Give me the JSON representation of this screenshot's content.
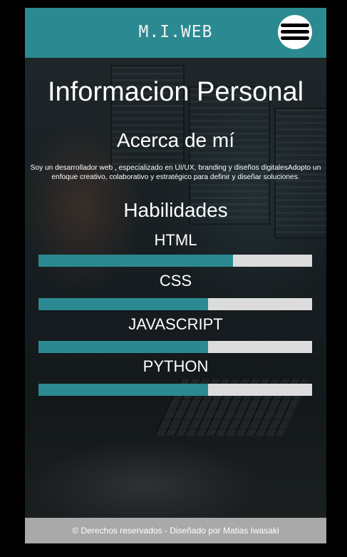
{
  "header": {
    "brand": "M.I.WEB",
    "menu_icon": "hamburger-menu-icon"
  },
  "main": {
    "title": "Informacion Personal",
    "about_heading": "Acerca de mí",
    "about_text": "Soy un desarrollador web , especializado en UI/UX, branding y diseños digitalesAdopto un enfoque creativo, colaborativo y estratégico para definir y diseñar soluciones.",
    "skills_heading": "Habilidades",
    "skills": [
      {
        "name": "HTML",
        "level": 0.71
      },
      {
        "name": "CSS",
        "level": 0.62
      },
      {
        "name": "JAVASCRIPT",
        "level": 0.62
      },
      {
        "name": "PYTHON",
        "level": 0.62
      }
    ]
  },
  "footer": {
    "text": "© Derechos reservados - Diseñado por Matias Iwasaki"
  },
  "colors": {
    "accent": "#2b8a91",
    "track": "#dcdcdc",
    "footer_bg": "#a9a9a9",
    "page_bg": "#000000"
  }
}
